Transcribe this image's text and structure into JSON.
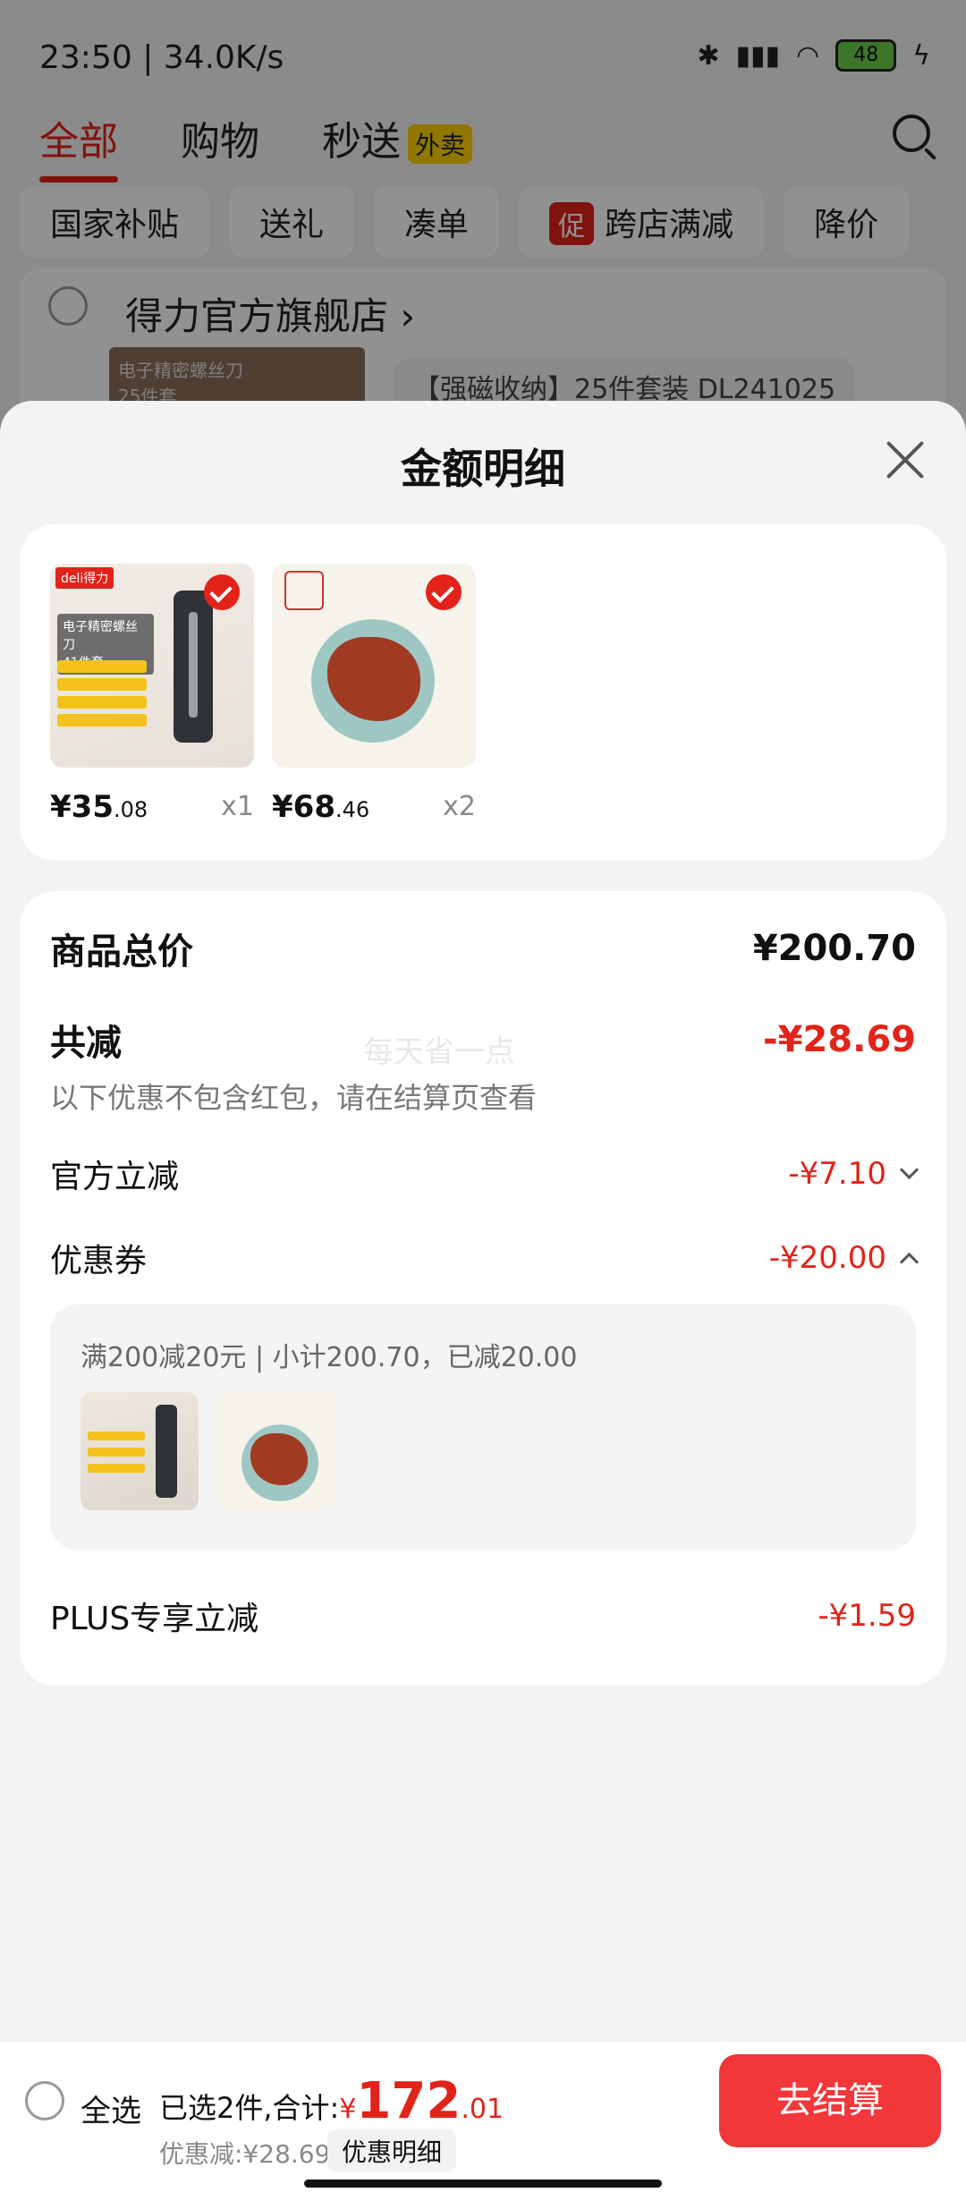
{
  "status_bar": {
    "time_speed": "23:50 | 34.0K/s",
    "battery": "48"
  },
  "top_tabs": {
    "all": "全部",
    "shopping": "购物",
    "express": "秒送",
    "express_badge": "外卖"
  },
  "filter_chips": {
    "subsidy": "国家补贴",
    "gift": "送礼",
    "combine": "凑单",
    "promo_tag": "促",
    "cross_store": "跨店满减",
    "price_drop": "降价"
  },
  "store": {
    "name": "得力官方旗舰店",
    "thumb_text": "电子精密螺丝刀",
    "thumb_sub": "25件套",
    "product_title": "【强磁收纳】25件套装 DL241025"
  },
  "sheet": {
    "title": "金额明细"
  },
  "items": [
    {
      "price_int": "¥35",
      "price_dec": ".08",
      "qty": "x1",
      "logo": "deli得力",
      "title": "电子精密螺丝刀",
      "subtitle": "41件套"
    },
    {
      "price_int": "¥68",
      "price_dec": ".46",
      "qty": "x2"
    }
  ],
  "detail": {
    "total_label": "商品总价",
    "total_value": "¥200.70",
    "saved_label": "共减",
    "saved_value": "-¥28.69",
    "note": "以下优惠不包含红包，请在结算页查看",
    "watermark": "每天省一点",
    "official_label": "官方立减",
    "official_value": "-¥7.10",
    "coupon_label": "优惠券",
    "coupon_value": "-¥20.00",
    "coupon_info": "满200减20元 | 小计200.70，已减20.00",
    "plus_label": "PLUS专享立减",
    "plus_value": "-¥1.59"
  },
  "bottom": {
    "select_all": "全选",
    "selected_summary": "已选2件,合计:",
    "total_yen": "¥",
    "total_int": "172",
    "total_dec": ".01",
    "discount": "优惠减:¥28.69",
    "detail_chip": "优惠明细",
    "checkout": "去结算"
  },
  "colors": {
    "accent": "#e2231a",
    "checkout": "#f2373b"
  }
}
